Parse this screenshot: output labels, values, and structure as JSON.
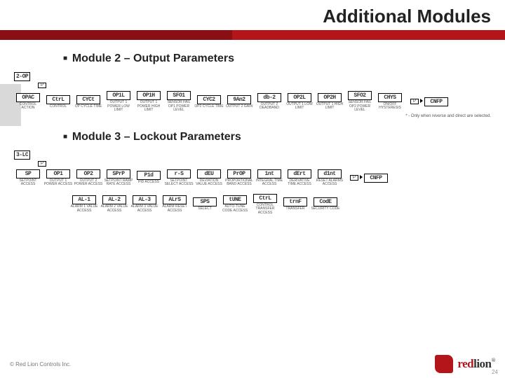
{
  "title": "Additional Modules",
  "section1": "Module 2 – Output Parameters",
  "section2": "Module 3 – Lockout Parameters",
  "note": "* - Only when reverse and direct are selected.",
  "entry1": "2-OP",
  "entry2": "3-LC",
  "p": "P",
  "end1": "CNFP",
  "end2": "CNFP",
  "m2": [
    {
      "code": "OPAC",
      "lbl": "CONTROL ACTION"
    },
    {
      "code": "CtrL",
      "lbl": "CONTROL"
    },
    {
      "code": "CYCt",
      "lbl": "OP CYCLE TIME"
    },
    {
      "code": "OP1L",
      "lbl": "OUTPUT 1 POWER LOW LIMIT"
    },
    {
      "code": "OP1H",
      "lbl": "OUTPUT 1 POWER HIGH LIMIT"
    },
    {
      "code": "SFO1",
      "lbl": "SENSOR FAIL OP1 POWER LEVEL"
    },
    {
      "code": "CYC2",
      "lbl": "OP2 CYCLE TIME"
    },
    {
      "code": "9An2",
      "lbl": "OUTPUT 2 GAIN"
    },
    {
      "code": "db-2",
      "lbl": "OUTPUT 2 DEADBAND"
    },
    {
      "code": "OP2L",
      "lbl": "OUTPUT 1 LOW LIMIT"
    },
    {
      "code": "OP2H",
      "lbl": "OUTPUT 1 HIGH LIMIT"
    },
    {
      "code": "SFO2",
      "lbl": "SENSOR FAIL OP2 POWER LEVEL"
    },
    {
      "code": "CHYS",
      "lbl": "ON/OFF HYSTERESIS"
    }
  ],
  "m3a": [
    {
      "code": "SP",
      "lbl": "SETPOINT ACCESS"
    },
    {
      "code": "OP1",
      "lbl": "OUTPUT 1 POWER ACCESS"
    },
    {
      "code": "OP2",
      "lbl": "OUTPUT 2 POWER ACCESS"
    },
    {
      "code": "SPrP",
      "lbl": "SETPOINT RAMP RATE ACCESS"
    },
    {
      "code": "P1d",
      "lbl": "PID ACCESS"
    },
    {
      "code": "r-S",
      "lbl": "SETPOINT SELECT ACCESS"
    },
    {
      "code": "dEU",
      "lbl": "DEVIATION VALUE ACCESS"
    },
    {
      "code": "PrOP",
      "lbl": "PROPORTIONAL BAND ACCESS"
    },
    {
      "code": "1nt",
      "lbl": "INTEGRAL TIME ACCESS"
    },
    {
      "code": "dErt",
      "lbl": "DERIVATIVE TIME ACCESS"
    },
    {
      "code": "d1nt",
      "lbl": "RESET ALARMS ACCESS"
    }
  ],
  "m3b": [
    {
      "code": "AL-1",
      "lbl": "ALARM 1 VALUE ACCESS"
    },
    {
      "code": "AL-2",
      "lbl": "ALARM 2 VALUE ACCESS"
    },
    {
      "code": "AL-3",
      "lbl": "ALARM 3 VALUE ACCESS"
    },
    {
      "code": "ALrS",
      "lbl": "ALARM RESET ACCESS"
    },
    {
      "code": "SPS",
      "lbl": "SELECT"
    },
    {
      "code": "tUNE",
      "lbl": "AUTO-TUNE CODE ACCESS"
    },
    {
      "code": "CtrL",
      "lbl": "CONTROL TRANSFER ACCESS"
    },
    {
      "code": "trnF",
      "lbl": "TRANSFER"
    },
    {
      "code": "CodE",
      "lbl": "SECURITY CODE"
    }
  ],
  "copyright": "© Red Lion Controls Inc.",
  "logo": {
    "red": "red",
    "lion": "lion"
  },
  "page": "24"
}
